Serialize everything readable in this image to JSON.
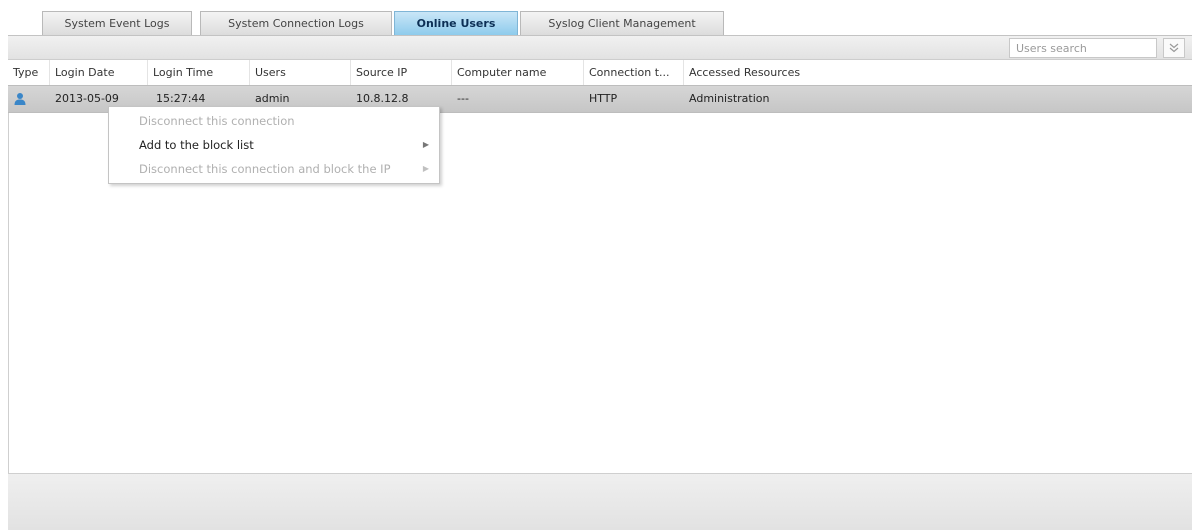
{
  "tabs": [
    {
      "label": "System Event Logs"
    },
    {
      "label": "System Connection Logs"
    },
    {
      "label": "Online Users"
    },
    {
      "label": "Syslog Client Management"
    }
  ],
  "search": {
    "placeholder": "Users search",
    "toggle_icon": "double-chevron-down-icon"
  },
  "table": {
    "columns": [
      "Type",
      "Login Date",
      "Login Time",
      "Users",
      "Source IP",
      "Computer name",
      "Connection t...",
      "Accessed Resources"
    ],
    "rows": [
      {
        "type_icon": "user-icon",
        "login_date": "2013-05-09",
        "login_time": "15:27:44",
        "user": "admin",
        "source_ip": "10.8.12.8",
        "computer_name": "---",
        "connection_type": "HTTP",
        "accessed_resources": "Administration"
      }
    ]
  },
  "context_menu": {
    "items": [
      {
        "label": "Disconnect this connection",
        "disabled": true
      },
      {
        "label": "Add to the block list",
        "disabled": false
      },
      {
        "label": "Disconnect this connection and block the IP",
        "disabled": true
      }
    ]
  },
  "colors": {
    "active_tab": "#8ecbec",
    "user_icon": "#3a86c8",
    "selected_row": "#cfcfcf"
  }
}
